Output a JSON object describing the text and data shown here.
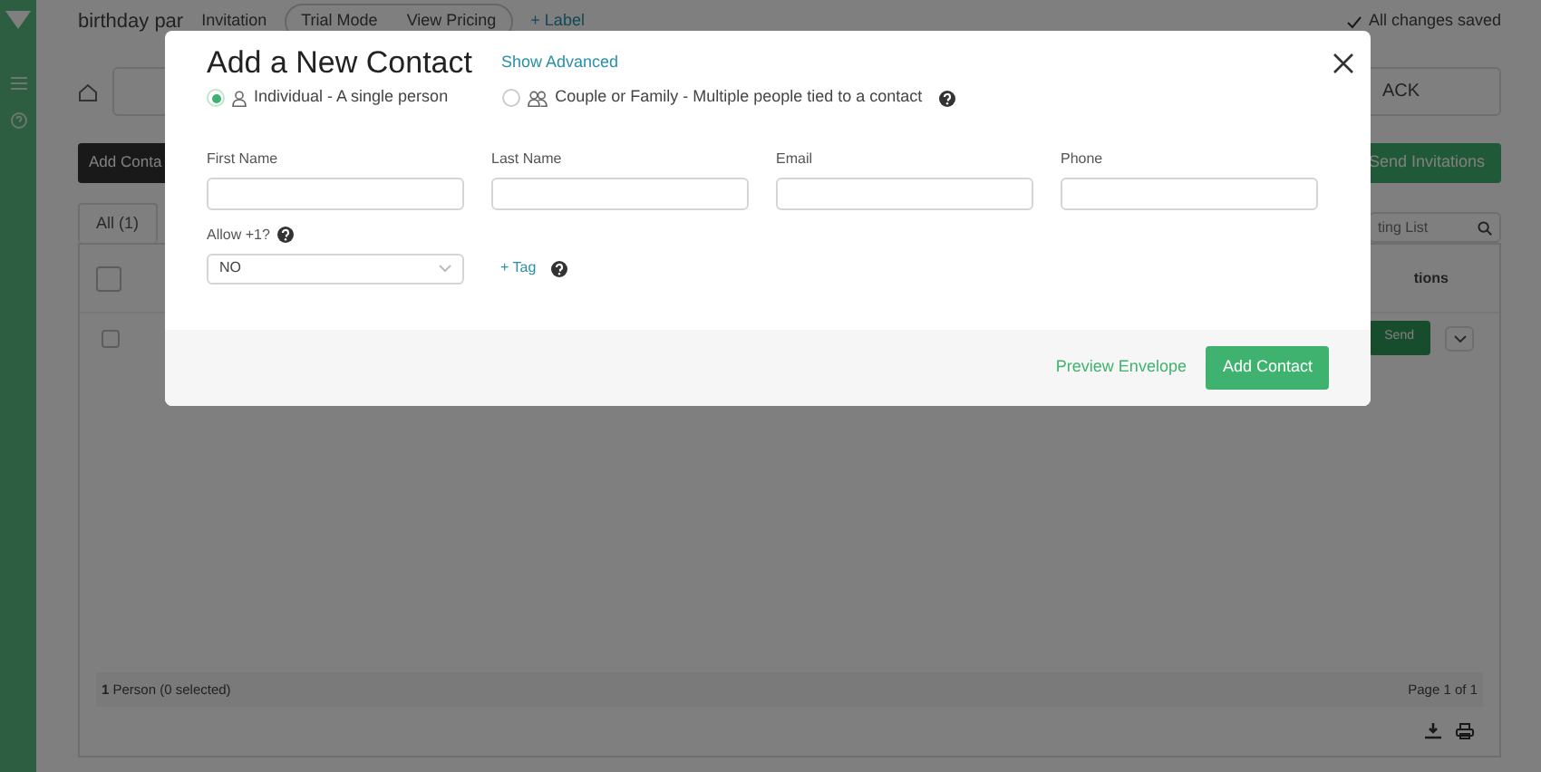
{
  "app": {
    "header": {
      "title": "birthday par",
      "type": "Invitation",
      "mode_buttons": [
        "Trial Mode",
        "View Pricing"
      ],
      "label_link": "+ Label",
      "save_status": "All changes saved"
    },
    "breadcrumb": "ACK",
    "add_button": "Add Conta",
    "send_button": "Send Invitations",
    "tabs": [
      {
        "label": "All (1)",
        "selected": true
      }
    ],
    "search": {
      "placeholder": "ting List"
    },
    "table": {
      "header_checked": false,
      "columns": [
        {
          "label": "tions"
        }
      ],
      "rows": [
        {
          "checked": false,
          "send": "Send"
        }
      ]
    },
    "footer": {
      "count": "**1** Person (0 selected)",
      "page": "Page 1 of 1"
    }
  },
  "dialog": {
    "title": "Add a New Contact",
    "advanced_link": "Show Advanced",
    "types": [
      {
        "kind": "single",
        "label": "Individual - A single person",
        "selected": true,
        "help": false
      },
      {
        "kind": "group",
        "label": "Couple or Family - Multiple people tied to a contact",
        "selected": false,
        "help": true
      }
    ],
    "fields": [
      {
        "label": "First Name"
      },
      {
        "label": "Last Name"
      },
      {
        "label": "Email"
      },
      {
        "label": "Phone"
      }
    ],
    "allow_plus_one": {
      "label": "Allow +1?",
      "value": "NO"
    },
    "tag_link": "+ Tag",
    "preview_link": "Preview Envelope",
    "submit": "Add Contact"
  }
}
